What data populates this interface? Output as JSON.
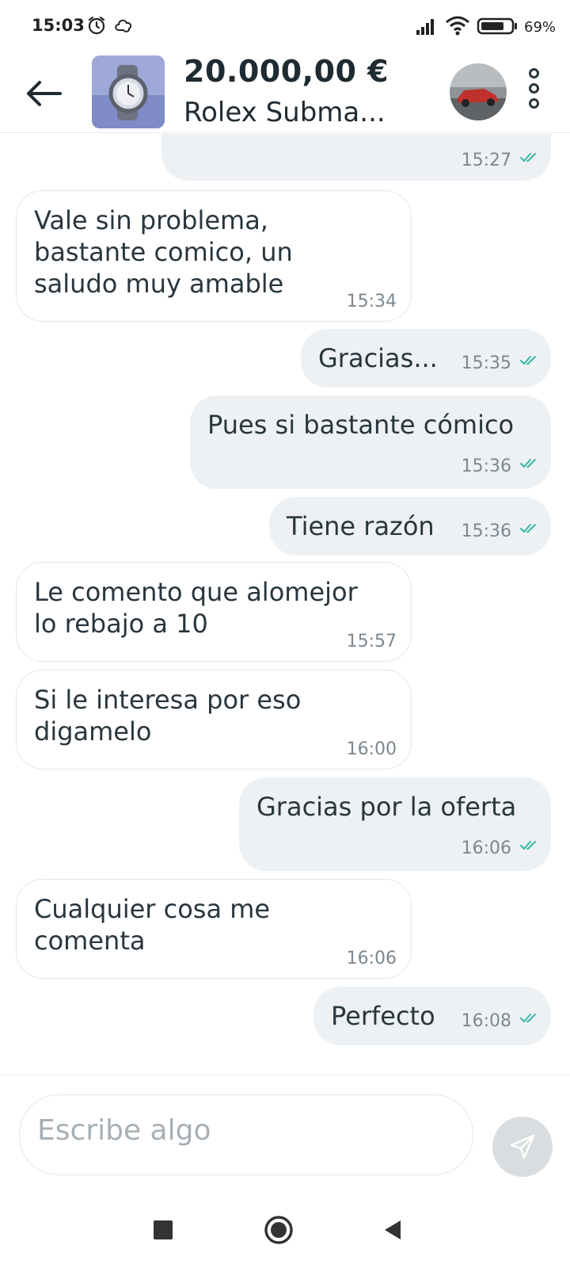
{
  "status_bar": {
    "time": "15:03",
    "battery_percent": "69%",
    "signal_icon": "signal-icon",
    "wifi_icon": "wifi-icon",
    "battery_icon": "battery-icon",
    "alarm_icon": "alarm-icon",
    "app_icon": "app-notification-icon"
  },
  "header": {
    "price": "20.000,00 €",
    "product_title": "Rolex Subma...",
    "back_icon": "back-arrow-icon",
    "menu_icon": "more-vertical-icon"
  },
  "messages": [
    {
      "direction": "out",
      "text_lines": [],
      "time": "15:27",
      "read": true
    },
    {
      "direction": "in",
      "text_lines": [
        "Vale sin problema,",
        "bastante comico, un",
        "saludo muy amable"
      ],
      "time": "15:34"
    },
    {
      "direction": "out",
      "text_lines": [
        "Gracias..."
      ],
      "time": "15:35",
      "read": true
    },
    {
      "direction": "out",
      "text_lines": [
        "Pues si bastante cómico"
      ],
      "time": "15:36",
      "read": true
    },
    {
      "direction": "out",
      "text_lines": [
        "Tiene razón"
      ],
      "time": "15:36",
      "read": true
    },
    {
      "direction": "in",
      "text_lines": [
        "Le comento que alomejor",
        "lo rebajo a 10"
      ],
      "time": "15:57"
    },
    {
      "direction": "in",
      "text_lines": [
        "Si le interesa por eso",
        "digamelo"
      ],
      "time": "16:00"
    },
    {
      "direction": "out",
      "text_lines": [
        "Gracias por la oferta"
      ],
      "time": "16:06",
      "read": true
    },
    {
      "direction": "in",
      "text_lines": [
        "Cualquier cosa me",
        "comenta"
      ],
      "time": "16:06"
    },
    {
      "direction": "out",
      "text_lines": [
        "Perfecto"
      ],
      "time": "16:08",
      "read": true
    }
  ],
  "composer": {
    "placeholder": "Escribe algo",
    "send_icon": "send-icon"
  },
  "nav_bar": {
    "recents_icon": "recents-square-icon",
    "home_icon": "home-circle-icon",
    "back_icon": "back-triangle-icon"
  },
  "colors": {
    "outgoing_bubble": "#edf1f4",
    "incoming_border": "#e3e7ea",
    "read_check": "#3ab5a5",
    "text": "#29363d"
  }
}
